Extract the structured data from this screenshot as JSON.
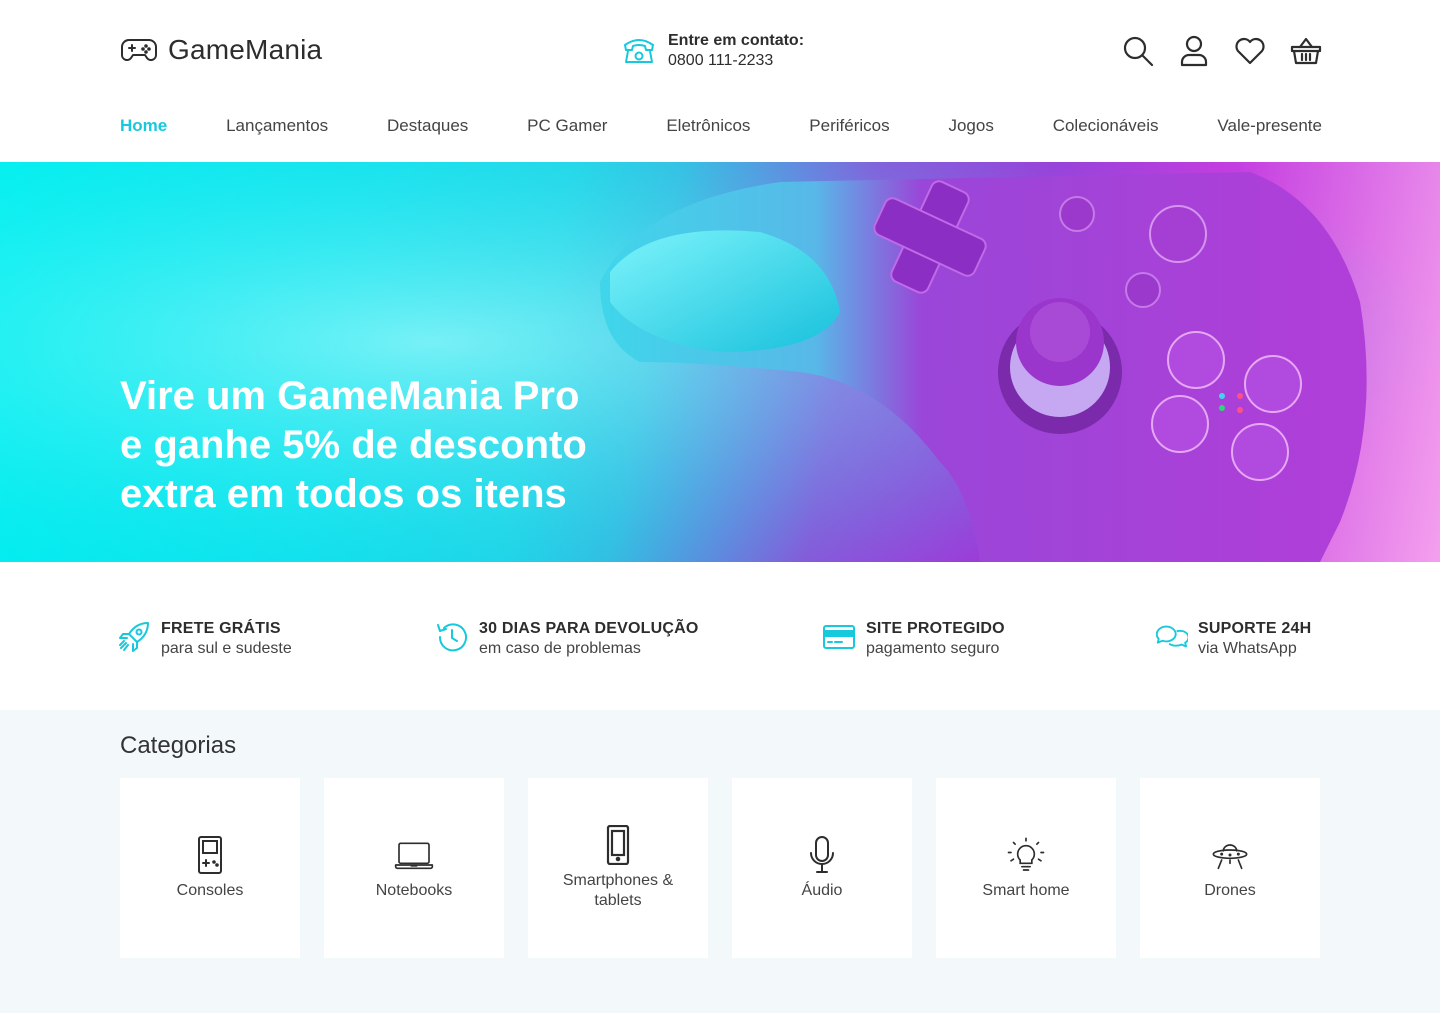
{
  "brand": {
    "name": "GameMania",
    "accent": "#17c9dc"
  },
  "contact": {
    "title": "Entre em contato:",
    "phone": "0800 111-2233"
  },
  "header_icons": [
    "search-icon",
    "user-icon",
    "heart-icon",
    "basket-icon"
  ],
  "nav": [
    {
      "label": "Home",
      "active": true
    },
    {
      "label": "Lançamentos"
    },
    {
      "label": "Destaques"
    },
    {
      "label": "PC Gamer"
    },
    {
      "label": "Eletrônicos"
    },
    {
      "label": "Periféricos"
    },
    {
      "label": "Jogos"
    },
    {
      "label": "Colecionáveis"
    },
    {
      "label": "Vale-presente"
    }
  ],
  "hero": {
    "lines": [
      "Vire um GameMania Pro",
      "e ganhe 5% de desconto",
      "extra em todos os itens"
    ]
  },
  "features": [
    {
      "icon": "rocket-icon",
      "title": "FRETE GRÁTIS",
      "subtitle": "para sul e sudeste"
    },
    {
      "icon": "history-icon",
      "title": "30 DIAS PARA DEVOLUÇÃO",
      "subtitle": "em caso de problemas"
    },
    {
      "icon": "credit-card-icon",
      "title": "SITE PROTEGIDO",
      "subtitle": "pagamento seguro"
    },
    {
      "icon": "chat-icon",
      "title": "SUPORTE 24H",
      "subtitle": "via WhatsApp"
    }
  ],
  "categories": {
    "title": "Categorias",
    "items": [
      {
        "icon": "handheld-console-icon",
        "label": "Consoles"
      },
      {
        "icon": "laptop-icon",
        "label": "Notebooks"
      },
      {
        "icon": "smartphone-icon",
        "label": "Smartphones & tablets"
      },
      {
        "icon": "microphone-icon",
        "label": "Áudio"
      },
      {
        "icon": "lightbulb-icon",
        "label": "Smart home"
      },
      {
        "icon": "ufo-icon",
        "label": "Drones"
      }
    ]
  }
}
